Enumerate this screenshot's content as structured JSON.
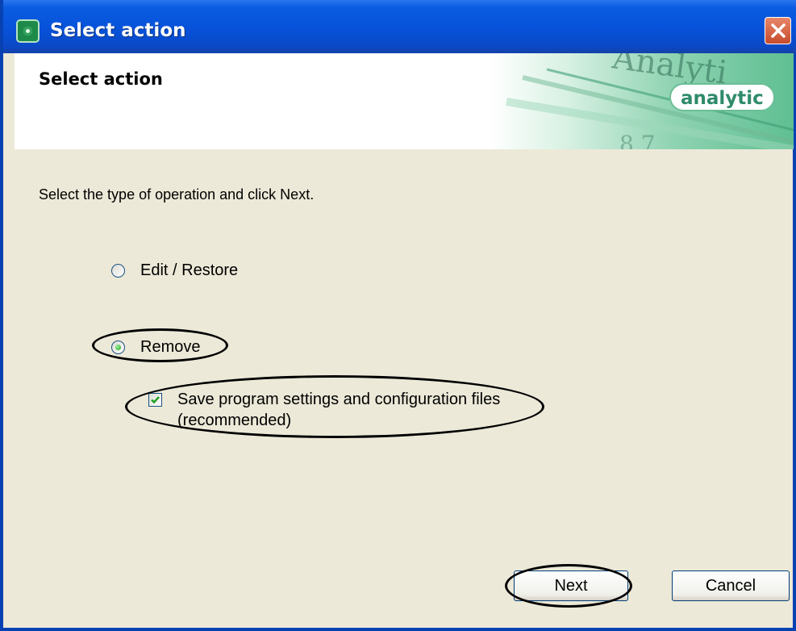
{
  "window": {
    "title": "Select action"
  },
  "header": {
    "title": "Select action",
    "brand": "analytic",
    "banner_watermark": "Analyti"
  },
  "content": {
    "instruction": "Select the type of operation and click Next.",
    "options": [
      {
        "label": "Edit / Restore",
        "selected": false
      },
      {
        "label": "Remove",
        "selected": true
      }
    ],
    "save_settings": {
      "line1": "Save program settings and configuration files",
      "line2": "(recommended)",
      "checked": true
    }
  },
  "buttons": {
    "next": "Next",
    "cancel": "Cancel"
  },
  "colors": {
    "titlebar": "#0A5CE0",
    "dialog_bg": "#ECE9D8",
    "brand": "#2E8B6A",
    "close": "#C74B2C"
  }
}
